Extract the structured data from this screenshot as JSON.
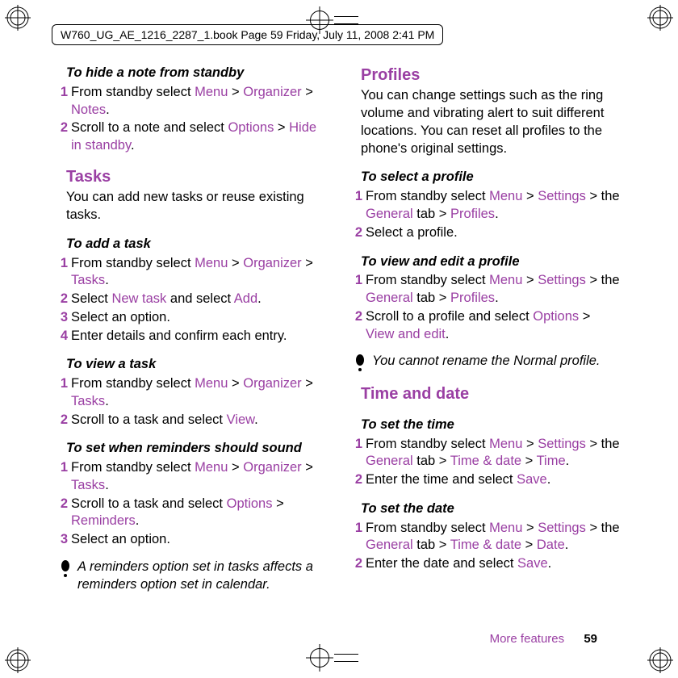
{
  "header": "W760_UG_AE_1216_2287_1.book  Page 59  Friday, July 11, 2008  2:41 PM",
  "footer": {
    "section": "More features",
    "page": "59"
  },
  "left": {
    "hide": {
      "title": "To hide a note from standby",
      "s1a": "From standby select ",
      "s1b": "Menu",
      "s1c": " > ",
      "s1d": "Organizer",
      "s1e": " > ",
      "s1f": "Notes",
      "s1g": ".",
      "s2a": "Scroll to a note and select ",
      "s2b": "Options",
      "s2c": " > ",
      "s2d": "Hide in standby",
      "s2e": "."
    },
    "tasks": {
      "heading": "Tasks",
      "intro": "You can add new tasks or reuse existing tasks."
    },
    "add": {
      "title": "To add a task",
      "s1a": "From standby select ",
      "s1b": "Menu",
      "s1c": " > ",
      "s1d": "Organizer",
      "s1e": " > ",
      "s1f": "Tasks",
      "s1g": ".",
      "s2a": "Select ",
      "s2b": "New task",
      "s2c": " and select ",
      "s2d": "Add",
      "s2e": ".",
      "s3": "Select an option.",
      "s4": "Enter details and confirm each entry."
    },
    "view": {
      "title": "To view a task",
      "s1a": "From standby select ",
      "s1b": "Menu",
      "s1c": " > ",
      "s1d": "Organizer",
      "s1e": " > ",
      "s1f": "Tasks",
      "s1g": ".",
      "s2a": "Scroll to a task and select ",
      "s2b": "View",
      "s2c": "."
    },
    "rem": {
      "title": "To set when reminders should sound",
      "s1a": "From standby select ",
      "s1b": "Menu",
      "s1c": " > ",
      "s1d": "Organizer",
      "s1e": " > ",
      "s1f": "Tasks",
      "s1g": ".",
      "s2a": "Scroll to a task and select ",
      "s2b": "Options",
      "s2c": " > ",
      "s2d": "Reminders",
      "s2e": ".",
      "s3": "Select an option."
    },
    "note": "A reminders option set in tasks affects a reminders option set in calendar."
  },
  "right": {
    "profiles": {
      "heading": "Profiles",
      "intro": "You can change settings such as the ring volume and vibrating alert to suit different locations. You can reset all profiles to the phone's original settings."
    },
    "select": {
      "title": "To select a profile",
      "s1a": "From standby select ",
      "s1b": "Menu",
      "s1c": " > ",
      "s1d": "Settings",
      "s1e": " > the ",
      "s1f": "General",
      "s1g": " tab > ",
      "s1h": "Profiles",
      "s1i": ".",
      "s2": "Select a profile."
    },
    "edit": {
      "title": "To view and edit a profile",
      "s1a": "From standby select ",
      "s1b": "Menu",
      "s1c": " > ",
      "s1d": "Settings",
      "s1e": " > the ",
      "s1f": "General",
      "s1g": " tab > ",
      "s1h": "Profiles",
      "s1i": ".",
      "s2a": "Scroll to a profile and select ",
      "s2b": "Options",
      "s2c": " > ",
      "s2d": "View and edit",
      "s2e": "."
    },
    "note": "You cannot rename the Normal profile.",
    "timedate": {
      "heading": "Time and date"
    },
    "settime": {
      "title": "To set the time",
      "s1a": "From standby select ",
      "s1b": "Menu",
      "s1c": " > ",
      "s1d": "Settings",
      "s1e": " > the ",
      "s1f": "General",
      "s1g": " tab > ",
      "s1h": "Time & date",
      "s1i": " > ",
      "s1j": "Time",
      "s1k": ".",
      "s2a": "Enter the time and select ",
      "s2b": "Save",
      "s2c": "."
    },
    "setdate": {
      "title": "To set the date",
      "s1a": "From standby select ",
      "s1b": "Menu",
      "s1c": " > ",
      "s1d": "Settings",
      "s1e": " > the ",
      "s1f": "General",
      "s1g": " tab > ",
      "s1h": "Time & date",
      "s1i": " > ",
      "s1j": "Date",
      "s1k": ".",
      "s2a": "Enter the date and select ",
      "s2b": "Save",
      "s2c": "."
    }
  }
}
